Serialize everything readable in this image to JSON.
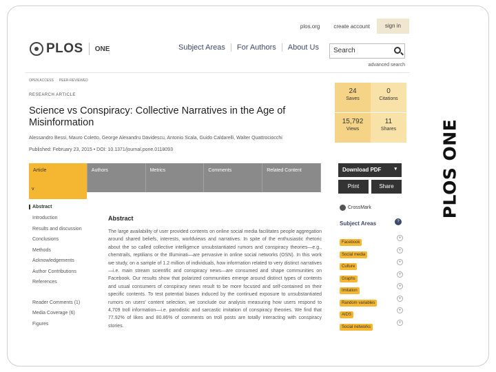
{
  "slide": {
    "side_title": "PLOS ONE"
  },
  "util": {
    "plos_org": "plos.org",
    "create_account": "create account",
    "sign_in": "sign in"
  },
  "header": {
    "logo_plos": "PLOS",
    "logo_one": "ONE",
    "nav": [
      "Subject Areas",
      "For Authors",
      "About Us"
    ],
    "search_placeholder": "Search",
    "advanced_search": "advanced search"
  },
  "article": {
    "top_links": [
      "OPEN ACCESS",
      "PEER-REVIEWED"
    ],
    "type": "RESEARCH ARTICLE",
    "title": "Science vs Conspiracy: Collective Narratives in the Age of Misinformation",
    "authors": "Alessandro Bessi, Mauro Coletto, George Alexandru Davidescu, Antonio Scala, Guido Caldarelli, Walter Quattrociocchi",
    "pubinfo": "Published: February 23, 2015  •  DOI: 10.1371/journal.pone.0118093"
  },
  "metrics": [
    {
      "num": "24",
      "label": "Saves"
    },
    {
      "num": "0",
      "label": "Citations"
    },
    {
      "num": "15,792",
      "label": "Views"
    },
    {
      "num": "11",
      "label": "Shares"
    }
  ],
  "tabs": [
    "Article",
    "Authors",
    "Metrics",
    "Comments",
    "Related Content"
  ],
  "tab_toggle": "v",
  "actions": {
    "download": "Download PDF",
    "download_caret": "▾",
    "print": "Print",
    "share": "Share",
    "crossmark": "CrossMark"
  },
  "sidebar": {
    "active": "Abstract",
    "items": [
      "Introduction",
      "Results and discussion",
      "Conclusions",
      "Methods",
      "Acknowledgements",
      "Author Contributions",
      "References"
    ],
    "extra": [
      "Reader Comments (1)",
      "Media Coverage (6)",
      "Figures"
    ]
  },
  "abstract": {
    "heading": "Abstract",
    "text": "The large availability of user provided contents on online social media facilitates people aggregation around shared beliefs, interests, worldviews and narratives. In spite of the enthusiastic rhetoric about the so called collective intelligence unsubstantiated rumors and conspiracy theories—e.g., chemtrails, reptilians or the Illuminati—are pervasive in online social networks (OSN). In this work we study, on a sample of 1.2 million of individuals, how information related to very distinct narratives—i.e. main stream scientific and conspiracy news—are consumed and shape communities on Facebook. Our results show that polarized communities emerge around distinct types of contents and usual consumers of conspiracy news result to be more focused and self-contained on their specific contents. To test potential biases induced by the continued exposure to unsubstantiated rumors on users' content selection, we conclude our analysis measuring how users respond to 4,709 troll information—i.e. parodistic and sarcastic imitation of conspiracy theories. We find that 77.92% of likes and 80.86% of comments on troll posts are totally interacting with conspiracy stories."
  },
  "subjects": {
    "heading": "Subject Areas",
    "help": "?",
    "items": [
      "Facebook",
      "Social media",
      "Culture",
      "Graphs",
      "Imitation",
      "Random variables",
      "AIDS",
      "Social networks"
    ]
  }
}
